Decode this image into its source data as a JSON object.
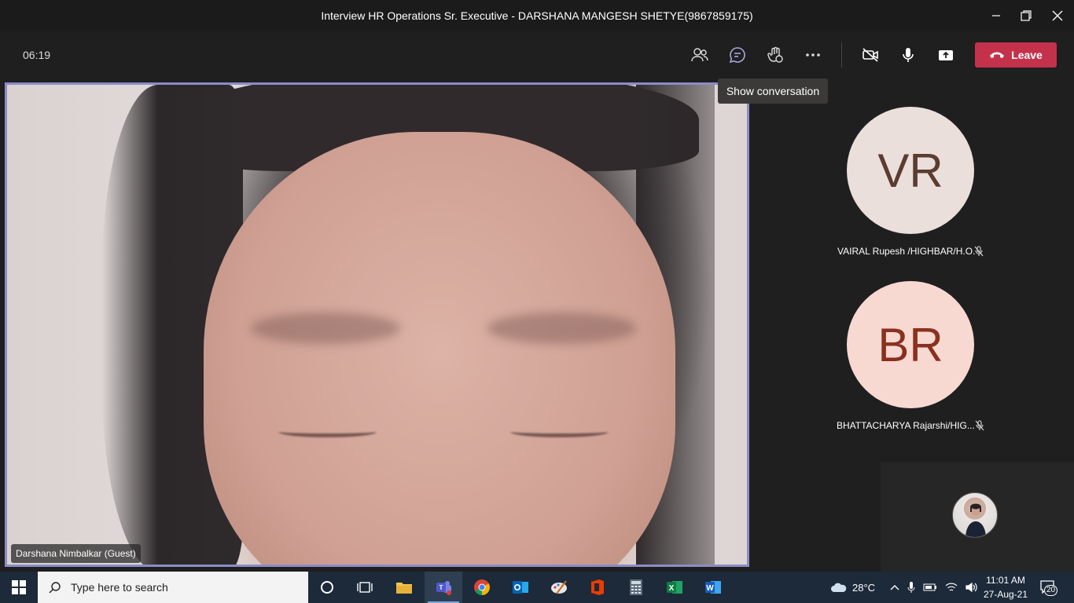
{
  "window": {
    "title": "Interview HR Operations Sr. Executive - DARSHANA MANGESH SHETYE(9867859175)",
    "controls": [
      "minimize-icon",
      "restore-icon",
      "close-icon"
    ]
  },
  "toolbar": {
    "timer": "06:19",
    "buttons": [
      "participants-icon",
      "chat-icon",
      "raise-hand-icon",
      "more-options-icon",
      "camera-off-icon",
      "microphone-icon",
      "share-tray-icon"
    ],
    "leave_label": "Leave",
    "leave_color": "#c4314b",
    "tooltip": "Show conversation"
  },
  "main_video": {
    "name_label": "Darshana Nimbalkar (Guest)",
    "border_color": "#8b8cc7"
  },
  "participants": [
    {
      "initials": "VR",
      "name": "VAIRAL Rupesh /HIGHBAR/H.O.",
      "avatar_bg": "#eadfdb",
      "avatar_fg": "#5c3c30",
      "muted": true
    },
    {
      "initials": "BR",
      "name": "BHATTACHARYA Rajarshi/HIG...",
      "avatar_bg": "#f8d9d2",
      "avatar_fg": "#8a3020",
      "muted": true
    }
  ],
  "taskbar": {
    "search_placeholder": "Type here to search",
    "apps": [
      "windows-start-icon",
      "cortana-icon",
      "task-view-icon",
      "file-explorer-icon",
      "teams-icon",
      "chrome-icon",
      "outlook-icon",
      "paint-icon",
      "office-icon",
      "calculator-icon",
      "excel-icon",
      "word-icon"
    ],
    "weather": "28°C",
    "time": "11:01 AM",
    "date": "27-Aug-21",
    "notifications": "20"
  }
}
